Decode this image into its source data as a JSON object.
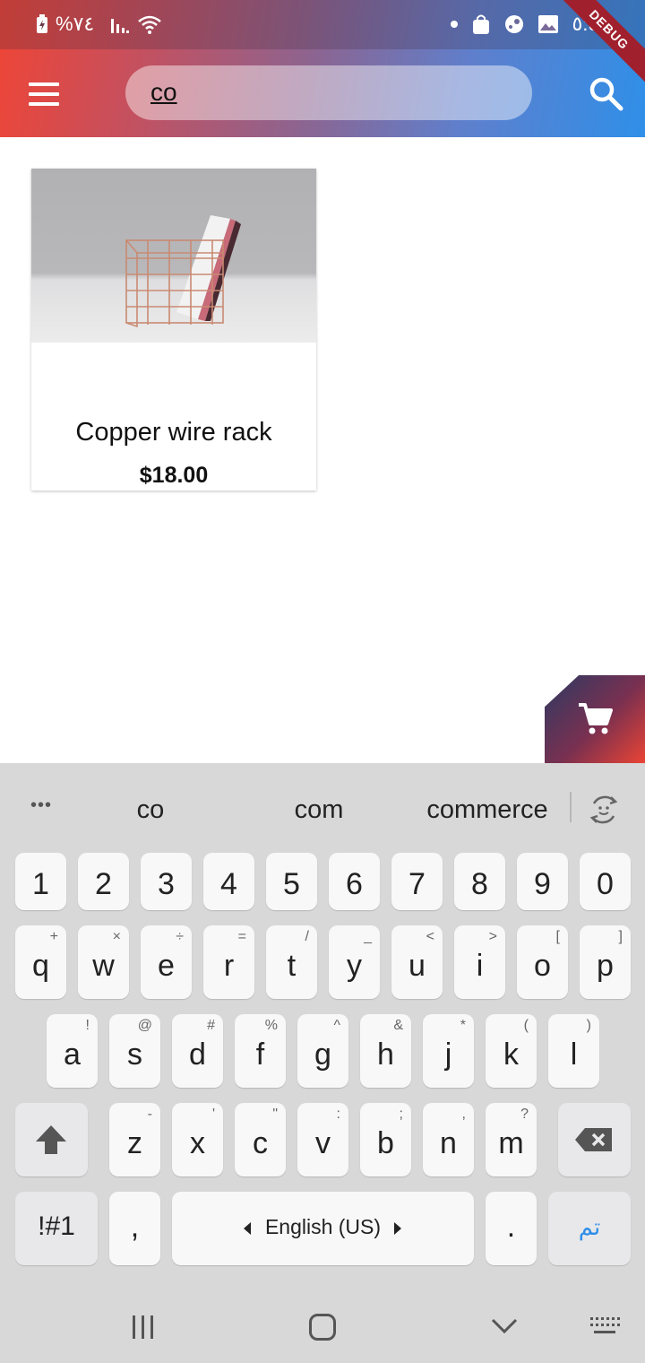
{
  "status_bar": {
    "battery": "%٧٤",
    "right_time": "٥:٥٧"
  },
  "debug_banner": "DEBUG",
  "app_bar": {
    "search_query": "co"
  },
  "products": [
    {
      "title": "Copper wire rack",
      "price": "$18.00"
    }
  ],
  "keyboard": {
    "suggestions": [
      "co",
      "com",
      "commerce"
    ],
    "more": "•••",
    "number_row": [
      "1",
      "2",
      "3",
      "4",
      "5",
      "6",
      "7",
      "8",
      "9",
      "0"
    ],
    "row1": [
      {
        "key": "q",
        "alt": "+"
      },
      {
        "key": "w",
        "alt": "×"
      },
      {
        "key": "e",
        "alt": "÷"
      },
      {
        "key": "r",
        "alt": "="
      },
      {
        "key": "t",
        "alt": "/"
      },
      {
        "key": "y",
        "alt": "_"
      },
      {
        "key": "u",
        "alt": "<"
      },
      {
        "key": "i",
        "alt": ">"
      },
      {
        "key": "o",
        "alt": "["
      },
      {
        "key": "p",
        "alt": "]"
      }
    ],
    "row2": [
      {
        "key": "a",
        "alt": "!"
      },
      {
        "key": "s",
        "alt": "@"
      },
      {
        "key": "d",
        "alt": "#"
      },
      {
        "key": "f",
        "alt": "%"
      },
      {
        "key": "g",
        "alt": "^"
      },
      {
        "key": "h",
        "alt": "&"
      },
      {
        "key": "j",
        "alt": "*"
      },
      {
        "key": "k",
        "alt": "("
      },
      {
        "key": "l",
        "alt": ")"
      }
    ],
    "row3": [
      {
        "key": "z",
        "alt": "-"
      },
      {
        "key": "x",
        "alt": "'"
      },
      {
        "key": "c",
        "alt": "\""
      },
      {
        "key": "v",
        "alt": ":"
      },
      {
        "key": "b",
        "alt": ";"
      },
      {
        "key": "n",
        "alt": ","
      },
      {
        "key": "m",
        "alt": "?"
      }
    ],
    "symbols_label": "!#1",
    "comma": ",",
    "space_label": "English (US)",
    "period": ".",
    "done_label": "تم",
    "done_color": "#2e8ee8"
  },
  "icons": {
    "menu": "menu-icon",
    "search": "search-icon",
    "cart": "cart-icon",
    "backspace": "backspace-icon",
    "shift": "shift-icon"
  }
}
